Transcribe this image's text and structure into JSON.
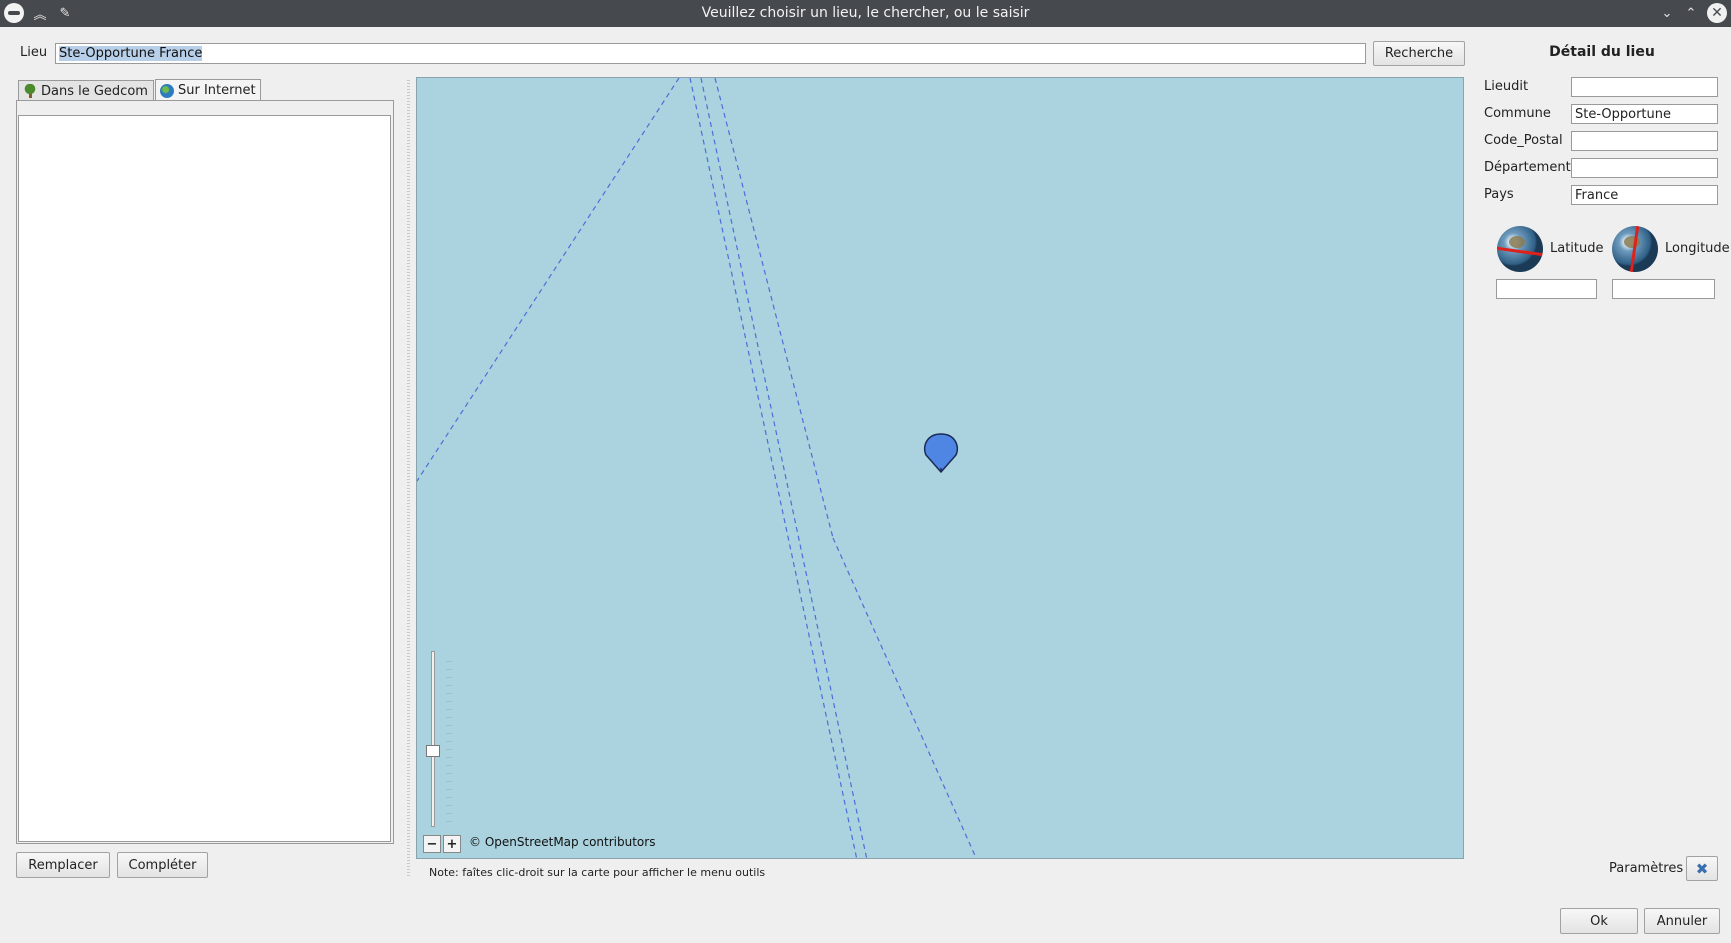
{
  "window": {
    "title": "Veuillez choisir un lieu, le chercher, ou le saisir"
  },
  "search": {
    "label": "Lieu",
    "value": "Ste-Opportune France",
    "button": "Recherche"
  },
  "tabs": [
    {
      "label": "Dans le Gedcom",
      "icon": "tree-icon"
    },
    {
      "label": "Sur Internet",
      "icon": "globe-icon"
    }
  ],
  "actions": {
    "replace": "Remplacer",
    "complete": "Compléter"
  },
  "map": {
    "attribution": "© OpenStreetMap contributors",
    "zoom_out": "−",
    "zoom_in": "+",
    "note": "Note: faîtes clic-droit sur la carte pour afficher le menu outils"
  },
  "detail": {
    "title": "Détail du lieu",
    "fields": [
      {
        "label": "Lieudit",
        "value": ""
      },
      {
        "label": "Commune",
        "value": "Ste-Opportune"
      },
      {
        "label": "Code_Postal",
        "value": ""
      },
      {
        "label": "Département",
        "value": ""
      },
      {
        "label": "Pays",
        "value": "France"
      }
    ],
    "latitude_label": "Latitude",
    "latitude_value": "",
    "longitude_label": "Longitude",
    "longitude_value": "",
    "params_label": "Paramètres"
  },
  "footer": {
    "ok": "Ok",
    "cancel": "Annuler"
  }
}
